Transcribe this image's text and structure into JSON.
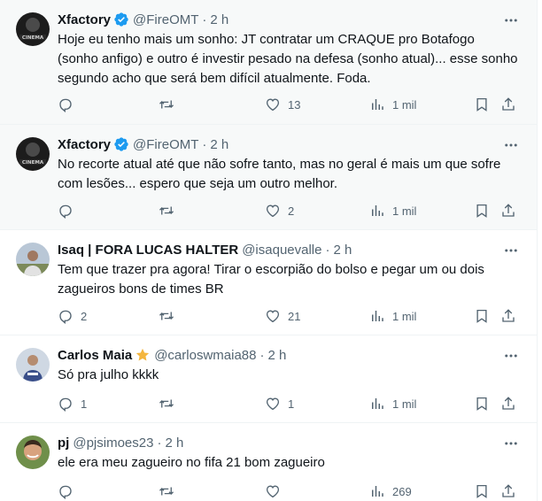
{
  "colors": {
    "text": "#0f1419",
    "muted": "#536471",
    "verified": "#1d9bf0",
    "star": "#f4b63f"
  },
  "tweets": [
    {
      "name": "Xfactory",
      "verified": true,
      "handle": "@FireOMT",
      "time": "2 h",
      "text": "Hoje eu tenho mais um sonho: JT contratar um CRAQUE pro Botafogo (sonho anfigo) e outro é investir pesado na defesa (sonho atual)... esse sonho segundo acho que será bem difícil atualmente. Foda.",
      "replies": "",
      "retweets": "",
      "likes": "13",
      "views": "1 mil"
    },
    {
      "name": "Xfactory",
      "verified": true,
      "handle": "@FireOMT",
      "time": "2 h",
      "text": "No recorte atual até que não sofre tanto, mas no geral é mais um que sofre com lesões... espero que seja um outro melhor.",
      "replies": "",
      "retweets": "",
      "likes": "2",
      "views": "1 mil"
    },
    {
      "name": "Isaq | FORA LUCAS HALTER",
      "verified": false,
      "handle": "@isaquevalle",
      "time": "2 h",
      "text": "Tem que trazer pra agora! Tirar o escorpião do bolso e pegar um ou dois zagueiros bons de times BR",
      "replies": "2",
      "retweets": "",
      "likes": "21",
      "views": "1 mil"
    },
    {
      "name": "Carlos Maia",
      "verified": false,
      "handle": "@carloswmaia88",
      "time": "2 h",
      "text": "Só pra julho kkkk",
      "replies": "1",
      "retweets": "",
      "likes": "1",
      "views": "1 mil"
    },
    {
      "name": "pj",
      "verified": false,
      "handle": "@pjsimoes23",
      "time": "2 h",
      "text": "ele era meu zagueiro no fifa 21 bom zagueiro",
      "replies": "",
      "retweets": "",
      "likes": "",
      "views": "269"
    }
  ]
}
